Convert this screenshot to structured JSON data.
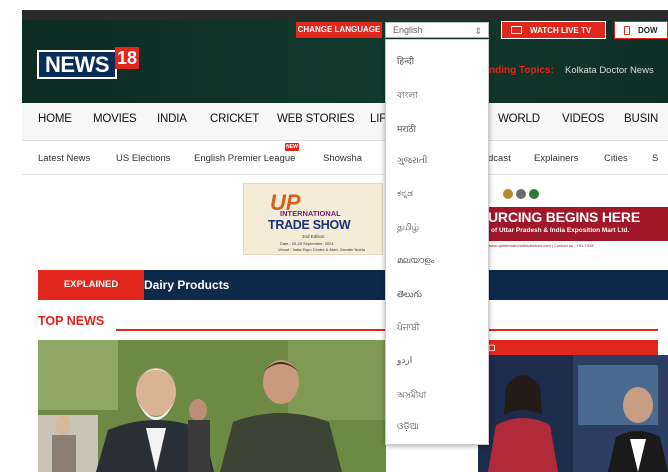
{
  "header": {
    "logo_text": "NEWS",
    "logo_number": "18",
    "change_language_label": "CHANGE LANGUAGE",
    "language_select_value": "English",
    "watch_live_label": "WATCH LIVE TV",
    "download_label": "DOW",
    "trending_label": "nding Topics:",
    "trending_value": "Kolkata Doctor News"
  },
  "nav": {
    "items": [
      "HOME",
      "MOVIES",
      "INDIA",
      "CRICKET",
      "WEB STORIES",
      "LIF",
      "WORLD",
      "VIDEOS",
      "BUSIN"
    ]
  },
  "subnav": {
    "items": [
      "Latest News",
      "US Elections",
      "English Premier League",
      "Showsha",
      "dcast",
      "Explainers",
      "Cities",
      "S"
    ],
    "new_badge": "NEW"
  },
  "ads": {
    "left": {
      "logo_text": "UP",
      "line1": "INTERNATIONAL",
      "line2": "TRADE SHOW",
      "edition": "2nd Edition",
      "dates": "Date : 25-29 September, 2024",
      "venue": "Venue : India Expo Centre & Mart, Greater Noida"
    },
    "right": {
      "headline": "URCING BEGINS HERE",
      "subline": "of Uttar Pradesh & India Exposition Mart Ltd.",
      "contact": "www.upinternationaltradeshow.com | Contact us : +91-7428"
    }
  },
  "explained": {
    "tag": "EXPLAINED",
    "topic": "Dairy Products"
  },
  "top_news": {
    "title": "TOP NEWS"
  },
  "language_dropdown": {
    "options": [
      "हिन्दी",
      "বাংলা",
      "मराठी",
      "ગુજરાતી",
      "ಕನ್ನಡ",
      "தமிழ்",
      "മലയാളം",
      "తెలుగు",
      "ਪੰਜਾਬੀ",
      "اردو",
      "অসমীয়া",
      "ଓଡ଼ିଆ"
    ]
  },
  "colors": {
    "brand_red": "#e1261c",
    "header_dark_green": "#0d2b23",
    "explained_navy": "#0d2a4a"
  },
  "icons": {
    "tv": "tv-icon",
    "phone": "phone-icon",
    "select_caret": "chevron-updown-icon",
    "live": "live-tv-icon"
  }
}
